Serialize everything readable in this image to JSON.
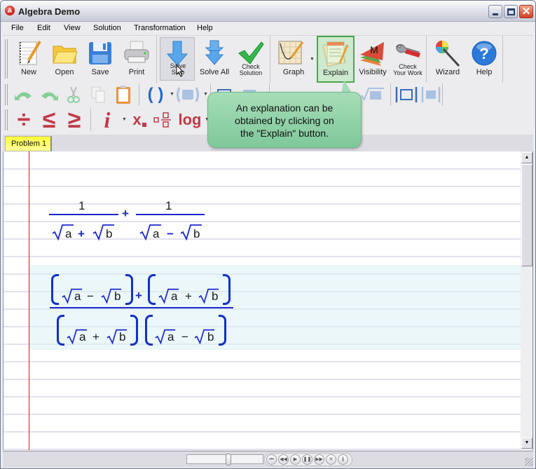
{
  "window": {
    "title": "Algebra Demo"
  },
  "menu": [
    "File",
    "Edit",
    "View",
    "Solution",
    "Transformation",
    "Help"
  ],
  "toolbar": {
    "new": "New",
    "open": "Open",
    "save": "Save",
    "print": "Print",
    "solve_step": "Solve Step",
    "solve_all": "Solve All",
    "check_solution_1": "Check",
    "check_solution_2": "Solution",
    "graph": "Graph",
    "explain": "Explain",
    "visibility": "Visibility",
    "check_work_1": "Check",
    "check_work_2": "Your Work",
    "wizard": "Wizard",
    "help": "Help",
    "visibility_glyph": "M",
    "help_glyph": "?"
  },
  "math_toolbar": {
    "parens": "( )",
    "divide": "÷",
    "leq": "≤",
    "geq": "≥",
    "imag": "i",
    "subscript": "x",
    "log": "log"
  },
  "tabs": [
    {
      "label": "Problem 1",
      "active": true
    }
  ],
  "tooltip": {
    "text_lines": [
      "An explanation can be",
      "obtained by clicking on",
      "the \"Explain\" button."
    ]
  },
  "expressions": {
    "original": {
      "numerator1": "1",
      "numerator2": "1",
      "op": "+",
      "den1": {
        "a": "a",
        "op": "+",
        "b": "b"
      },
      "den2": {
        "a": "a",
        "op": "−",
        "b": "b"
      }
    },
    "result": {
      "num_group1": {
        "a": "a",
        "op": "−",
        "b": "b"
      },
      "num_op": "+",
      "num_group2": {
        "a": "a",
        "op": "+",
        "b": "b"
      },
      "den_group1": {
        "a": "a",
        "op": "+",
        "b": "b"
      },
      "den_group2": {
        "a": "a",
        "op": "−",
        "b": "b"
      }
    }
  },
  "status": {
    "slider_value": 0.55,
    "player_buttons": [
      "first",
      "previous",
      "play",
      "pause",
      "next",
      "stop",
      "info"
    ]
  },
  "colors": {
    "math_blue": "#1b28c8",
    "margin_red": "#d2191a",
    "tab_yellow": "#ffff3a",
    "tooltip_green": "#8fd2a8"
  }
}
